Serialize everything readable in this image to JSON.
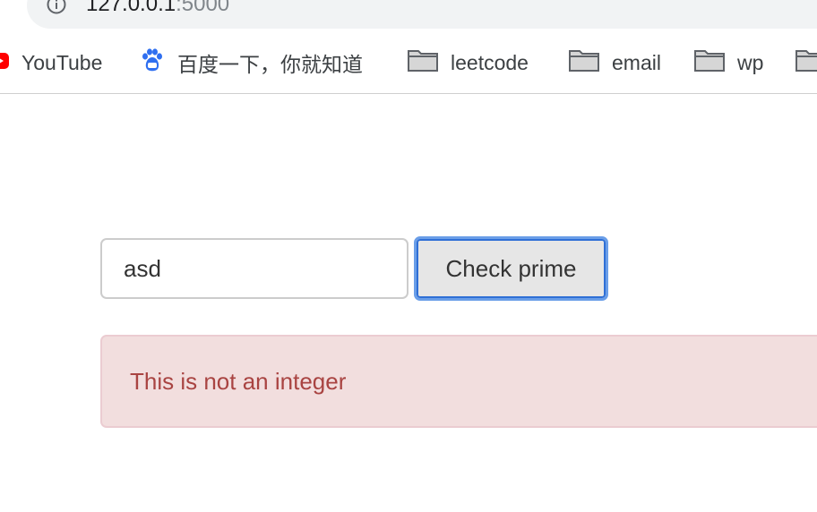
{
  "browser": {
    "url_host": "127.0.0.1",
    "url_port": ":5000",
    "bookmarks": [
      {
        "label": "YouTube",
        "icon": "youtube-icon"
      },
      {
        "label": "百度一下，你就知道",
        "icon": "baidu-paw-icon"
      },
      {
        "label": "leetcode",
        "icon": "folder-icon"
      },
      {
        "label": "email",
        "icon": "folder-icon"
      },
      {
        "label": "wp",
        "icon": "folder-icon"
      }
    ]
  },
  "form": {
    "input_value": "asd",
    "button_label": "Check prime"
  },
  "alert": {
    "message": "This is not an integer"
  },
  "colors": {
    "alert_background": "#f2dede",
    "alert_text": "#a94442",
    "button_focus_ring": "#2f6fd6"
  }
}
